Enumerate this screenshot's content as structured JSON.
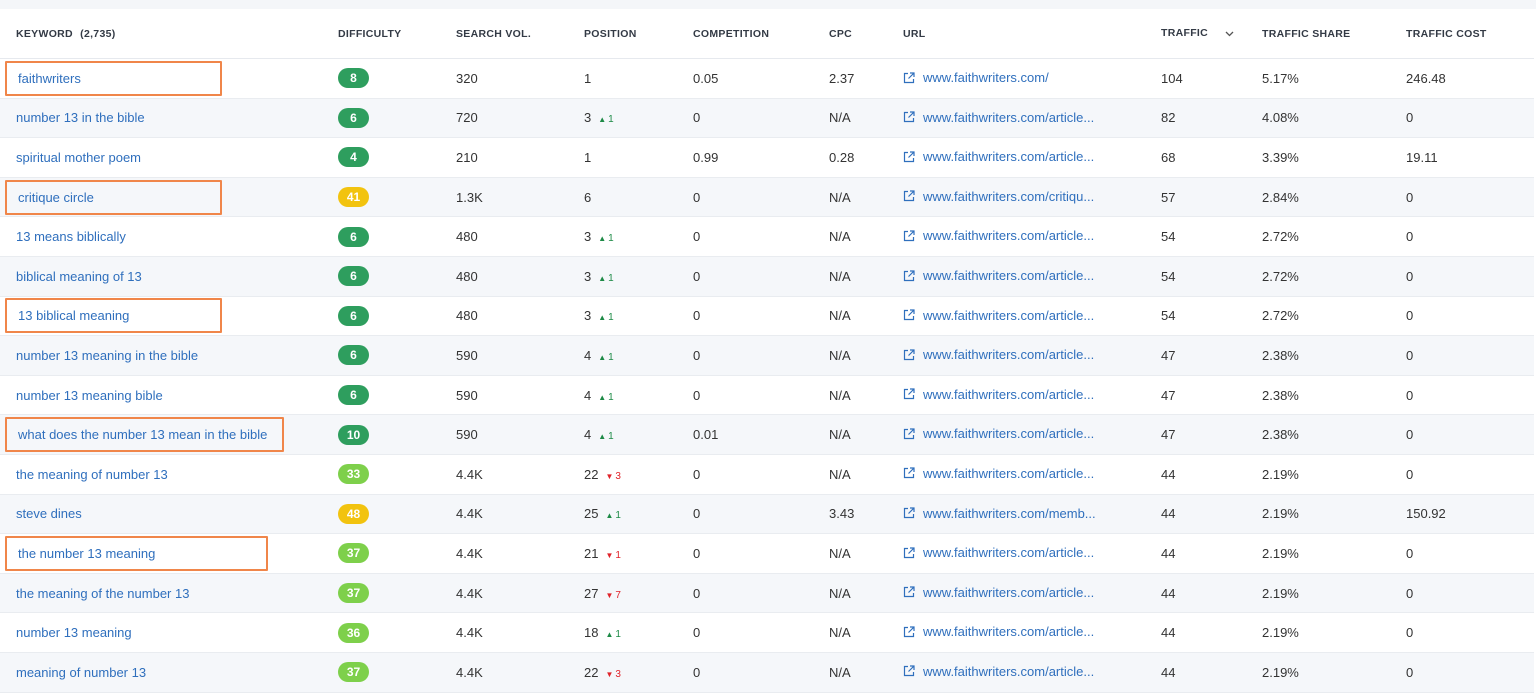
{
  "headers": {
    "keyword": "KEYWORD",
    "keyword_count": "(2,735)",
    "difficulty": "DIFFICULTY",
    "search_vol": "SEARCH VOL.",
    "position": "POSITION",
    "competition": "COMPETITION",
    "cpc": "CPC",
    "url": "URL",
    "traffic": "TRAFFIC",
    "traffic_share": "TRAFFIC SHARE",
    "traffic_cost": "TRAFFIC COST"
  },
  "colors": {
    "easy": "#2e9e5e",
    "light": "#7ed04b",
    "medium": "#f2c30f",
    "link": "#2f6fbd",
    "highlight_box": "#f0864a",
    "up": "#1d8a46",
    "down": "#e0232a"
  },
  "rows": [
    {
      "keyword": "faithwriters",
      "highlighted": true,
      "difficulty": "8",
      "diff_level": "easy",
      "search_vol": "320",
      "position": "1",
      "change": "",
      "change_dir": "",
      "competition": "0.05",
      "cpc": "2.37",
      "url": "www.faithwriters.com/",
      "traffic": "104",
      "traffic_share": "5.17%",
      "traffic_cost": "246.48"
    },
    {
      "keyword": "number 13 in the bible",
      "highlighted": false,
      "difficulty": "6",
      "diff_level": "easy",
      "search_vol": "720",
      "position": "3",
      "change": "1",
      "change_dir": "up",
      "competition": "0",
      "cpc": "N/A",
      "url": "www.faithwriters.com/article...",
      "traffic": "82",
      "traffic_share": "4.08%",
      "traffic_cost": "0"
    },
    {
      "keyword": "spiritual mother poem",
      "highlighted": false,
      "difficulty": "4",
      "diff_level": "easy",
      "search_vol": "210",
      "position": "1",
      "change": "",
      "change_dir": "",
      "competition": "0.99",
      "cpc": "0.28",
      "url": "www.faithwriters.com/article...",
      "traffic": "68",
      "traffic_share": "3.39%",
      "traffic_cost": "19.11"
    },
    {
      "keyword": "critique circle",
      "highlighted": true,
      "difficulty": "41",
      "diff_level": "medium",
      "search_vol": "1.3K",
      "position": "6",
      "change": "",
      "change_dir": "",
      "competition": "0",
      "cpc": "N/A",
      "url": "www.faithwriters.com/critiqu...",
      "traffic": "57",
      "traffic_share": "2.84%",
      "traffic_cost": "0"
    },
    {
      "keyword": "13 means biblically",
      "highlighted": false,
      "difficulty": "6",
      "diff_level": "easy",
      "search_vol": "480",
      "position": "3",
      "change": "1",
      "change_dir": "up",
      "competition": "0",
      "cpc": "N/A",
      "url": "www.faithwriters.com/article...",
      "traffic": "54",
      "traffic_share": "2.72%",
      "traffic_cost": "0"
    },
    {
      "keyword": "biblical meaning of 13",
      "highlighted": false,
      "difficulty": "6",
      "diff_level": "easy",
      "search_vol": "480",
      "position": "3",
      "change": "1",
      "change_dir": "up",
      "competition": "0",
      "cpc": "N/A",
      "url": "www.faithwriters.com/article...",
      "traffic": "54",
      "traffic_share": "2.72%",
      "traffic_cost": "0"
    },
    {
      "keyword": "13 biblical meaning",
      "highlighted": true,
      "difficulty": "6",
      "diff_level": "easy",
      "search_vol": "480",
      "position": "3",
      "change": "1",
      "change_dir": "up",
      "competition": "0",
      "cpc": "N/A",
      "url": "www.faithwriters.com/article...",
      "traffic": "54",
      "traffic_share": "2.72%",
      "traffic_cost": "0"
    },
    {
      "keyword": "number 13 meaning in the bible",
      "highlighted": false,
      "difficulty": "6",
      "diff_level": "easy",
      "search_vol": "590",
      "position": "4",
      "change": "1",
      "change_dir": "up",
      "competition": "0",
      "cpc": "N/A",
      "url": "www.faithwriters.com/article...",
      "traffic": "47",
      "traffic_share": "2.38%",
      "traffic_cost": "0"
    },
    {
      "keyword": "number 13 meaning bible",
      "highlighted": false,
      "difficulty": "6",
      "diff_level": "easy",
      "search_vol": "590",
      "position": "4",
      "change": "1",
      "change_dir": "up",
      "competition": "0",
      "cpc": "N/A",
      "url": "www.faithwriters.com/article...",
      "traffic": "47",
      "traffic_share": "2.38%",
      "traffic_cost": "0"
    },
    {
      "keyword": "what does the number 13 mean in the bible",
      "highlighted": true,
      "difficulty": "10",
      "diff_level": "easy",
      "search_vol": "590",
      "position": "4",
      "change": "1",
      "change_dir": "up",
      "competition": "0.01",
      "cpc": "N/A",
      "url": "www.faithwriters.com/article...",
      "traffic": "47",
      "traffic_share": "2.38%",
      "traffic_cost": "0"
    },
    {
      "keyword": "the meaning of number 13",
      "highlighted": false,
      "difficulty": "33",
      "diff_level": "light",
      "search_vol": "4.4K",
      "position": "22",
      "change": "3",
      "change_dir": "down",
      "competition": "0",
      "cpc": "N/A",
      "url": "www.faithwriters.com/article...",
      "traffic": "44",
      "traffic_share": "2.19%",
      "traffic_cost": "0"
    },
    {
      "keyword": "steve dines",
      "highlighted": false,
      "difficulty": "48",
      "diff_level": "medium",
      "search_vol": "4.4K",
      "position": "25",
      "change": "1",
      "change_dir": "up",
      "competition": "0",
      "cpc": "3.43",
      "url": "www.faithwriters.com/memb...",
      "traffic": "44",
      "traffic_share": "2.19%",
      "traffic_cost": "150.92"
    },
    {
      "keyword": "the number 13 meaning",
      "highlighted": true,
      "difficulty": "37",
      "diff_level": "light",
      "search_vol": "4.4K",
      "position": "21",
      "change": "1",
      "change_dir": "down",
      "competition": "0",
      "cpc": "N/A",
      "url": "www.faithwriters.com/article...",
      "traffic": "44",
      "traffic_share": "2.19%",
      "traffic_cost": "0"
    },
    {
      "keyword": "the meaning of the number 13",
      "highlighted": false,
      "difficulty": "37",
      "diff_level": "light",
      "search_vol": "4.4K",
      "position": "27",
      "change": "7",
      "change_dir": "down",
      "competition": "0",
      "cpc": "N/A",
      "url": "www.faithwriters.com/article...",
      "traffic": "44",
      "traffic_share": "2.19%",
      "traffic_cost": "0"
    },
    {
      "keyword": "number 13 meaning",
      "highlighted": false,
      "difficulty": "36",
      "diff_level": "light",
      "search_vol": "4.4K",
      "position": "18",
      "change": "1",
      "change_dir": "up",
      "competition": "0",
      "cpc": "N/A",
      "url": "www.faithwriters.com/article...",
      "traffic": "44",
      "traffic_share": "2.19%",
      "traffic_cost": "0"
    },
    {
      "keyword": "meaning of number 13",
      "highlighted": false,
      "difficulty": "37",
      "diff_level": "light",
      "search_vol": "4.4K",
      "position": "22",
      "change": "3",
      "change_dir": "down",
      "competition": "0",
      "cpc": "N/A",
      "url": "www.faithwriters.com/article...",
      "traffic": "44",
      "traffic_share": "2.19%",
      "traffic_cost": "0"
    }
  ]
}
